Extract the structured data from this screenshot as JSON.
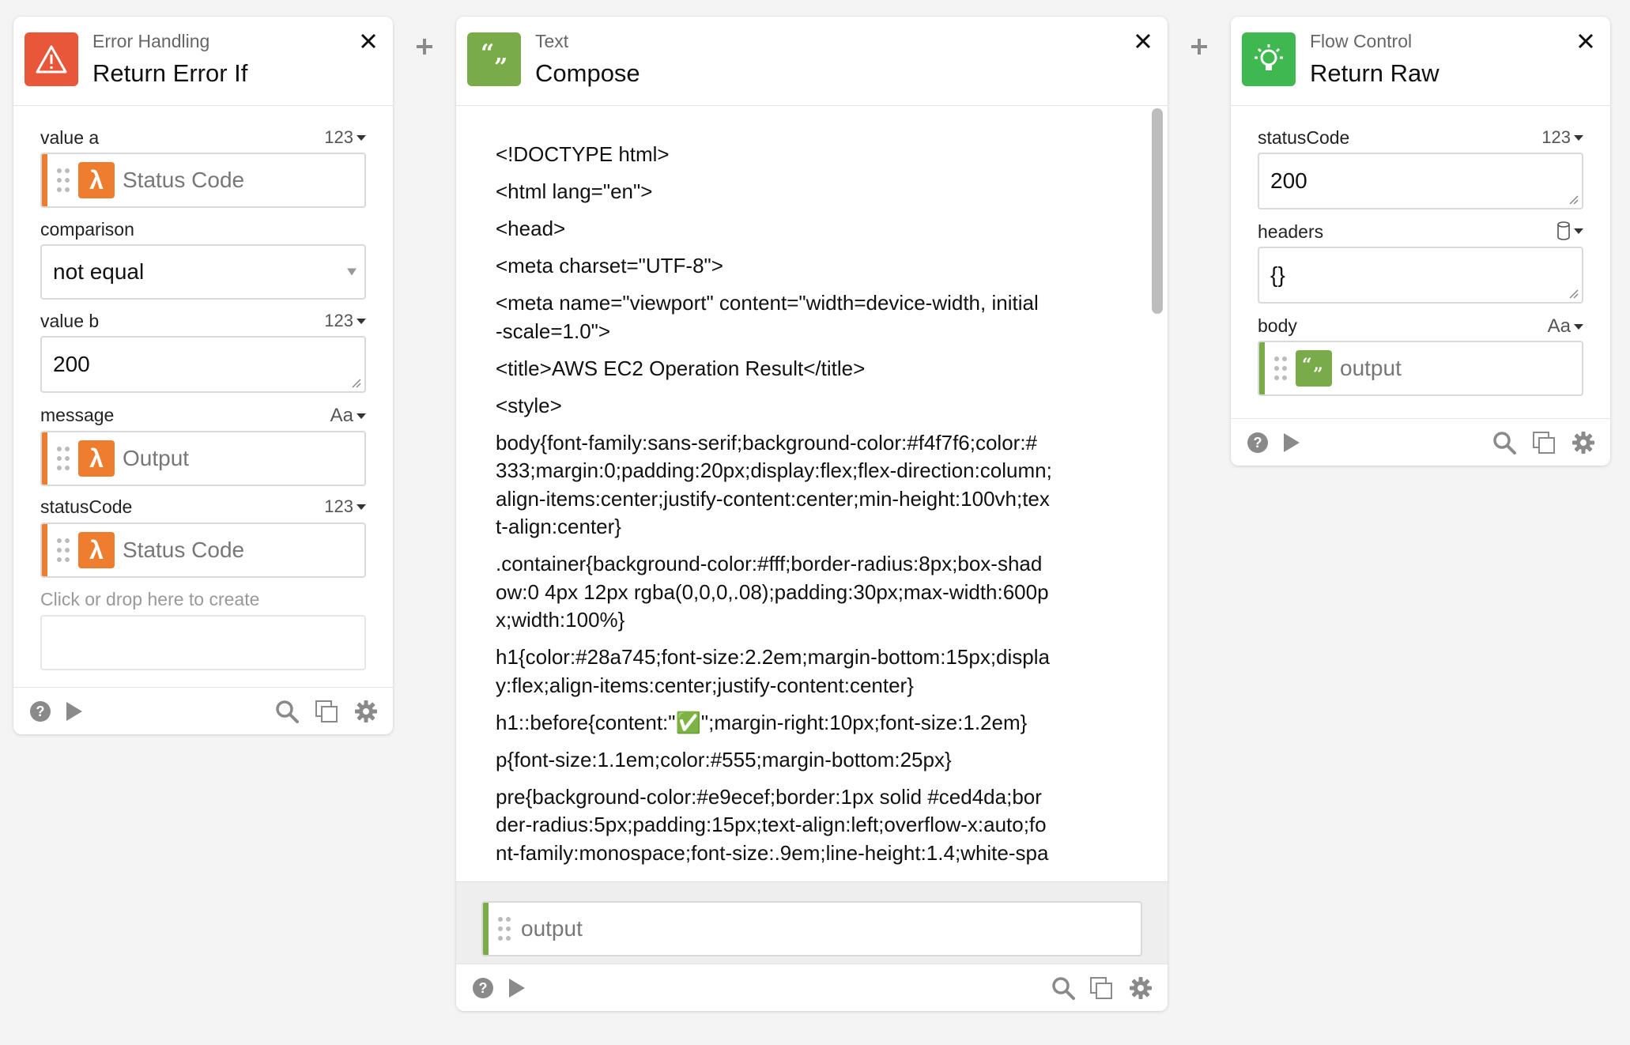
{
  "colors": {
    "error_orange": "#e8573a",
    "lambda_orange": "#ef7d2f",
    "text_green": "#79ab48",
    "flow_green": "#3fb94f"
  },
  "card_error": {
    "category": "Error Handling",
    "title": "Return Error If",
    "icon": "warning-triangle-icon",
    "fields": {
      "value_a": {
        "label": "value a",
        "type": "123",
        "token": "Status Code",
        "token_icon": "lambda-icon"
      },
      "comparison": {
        "label": "comparison",
        "value": "not equal"
      },
      "value_b": {
        "label": "value b",
        "type": "123",
        "value": "200"
      },
      "message": {
        "label": "message",
        "type": "Aa",
        "token": "Output",
        "token_icon": "lambda-icon"
      },
      "status_code": {
        "label": "statusCode",
        "type": "123",
        "token": "Status Code",
        "token_icon": "lambda-icon"
      }
    },
    "create_hint": "Click or drop here to create"
  },
  "card_text": {
    "category": "Text",
    "title": "Compose",
    "icon": "quote-icon",
    "code_lines": [
      "<!DOCTYPE html>",
      "<html lang=\"en\">",
      "<head>",
      " <meta charset=\"UTF-8\">",
      " <meta name=\"viewport\" content=\"width=device-width, initial",
      "-scale=1.0\">",
      " <title>AWS EC2 Operation Result</title>",
      " <style>",
      " body{font-family:sans-serif;background-color:#f4f7f6;color:#",
      "333;margin:0;padding:20px;display:flex;flex-direction:column;",
      "align-items:center;justify-content:center;min-height:100vh;tex",
      "t-align:center}",
      " .container{background-color:#fff;border-radius:8px;box-shad",
      "ow:0 4px 12px rgba(0,0,0,.08);padding:30px;max-width:600p",
      "x;width:100%}",
      " h1{color:#28a745;font-size:2.2em;margin-bottom:15px;displa",
      "y:flex;align-items:center;justify-content:center}",
      " h1::before{content:\"✅\";margin-right:10px;font-size:1.2em}",
      " p{font-size:1.1em;color:#555;margin-bottom:25px}",
      " pre{background-color:#e9ecef;border:1px solid #ced4da;bor",
      "der-radius:5px;padding:15px;text-align:left;overflow-x:auto;fo",
      "nt-family:monospace;font-size:.9em;line-height:1.4;white-spa"
    ],
    "output_label": "output"
  },
  "card_flow": {
    "category": "Flow Control",
    "title": "Return Raw",
    "icon": "lightbulb-icon",
    "fields": {
      "status_code": {
        "label": "statusCode",
        "type": "123",
        "value": "200"
      },
      "headers": {
        "label": "headers",
        "type_icon": "cylinder-icon",
        "value": "{}"
      },
      "body": {
        "label": "body",
        "type": "Aa",
        "token": "output",
        "token_icon": "quote-icon"
      }
    }
  }
}
